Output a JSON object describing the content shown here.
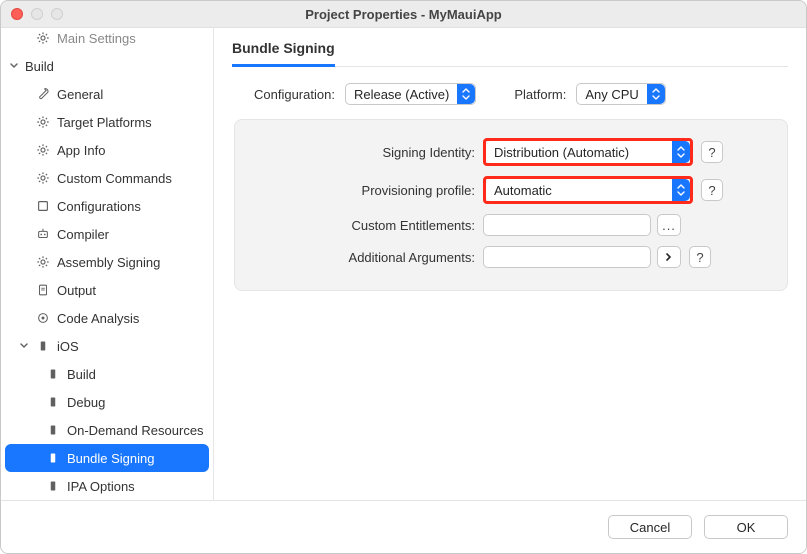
{
  "window": {
    "title": "Project Properties - MyMauiApp"
  },
  "sidebar": {
    "truncated_top": "Main Settings",
    "groups": [
      {
        "label": "Build",
        "items": [
          {
            "label": "General",
            "icon": "wrench"
          },
          {
            "label": "Target Platforms",
            "icon": "gear"
          },
          {
            "label": "App Info",
            "icon": "gear"
          },
          {
            "label": "Custom Commands",
            "icon": "gear"
          },
          {
            "label": "Configurations",
            "icon": "square"
          },
          {
            "label": "Compiler",
            "icon": "robot"
          },
          {
            "label": "Assembly Signing",
            "icon": "gear"
          },
          {
            "label": "Output",
            "icon": "doc"
          },
          {
            "label": "Code Analysis",
            "icon": "target"
          }
        ]
      },
      {
        "label": "iOS",
        "icon": "device",
        "items": [
          {
            "label": "Build",
            "icon": "device"
          },
          {
            "label": "Debug",
            "icon": "device"
          },
          {
            "label": "On-Demand Resources",
            "icon": "device"
          },
          {
            "label": "Bundle Signing",
            "icon": "device",
            "selected": true
          },
          {
            "label": "IPA Options",
            "icon": "device"
          }
        ]
      }
    ]
  },
  "main": {
    "heading": "Bundle Signing",
    "config": {
      "configuration_label": "Configuration:",
      "configuration_value": "Release (Active)",
      "platform_label": "Platform:",
      "platform_value": "Any CPU"
    },
    "form": {
      "signing_label": "Signing Identity:",
      "signing_value": "Distribution (Automatic)",
      "provisioning_label": "Provisioning profile:",
      "provisioning_value": "Automatic",
      "entitlements_label": "Custom Entitlements:",
      "entitlements_value": "",
      "arguments_label": "Additional Arguments:",
      "arguments_value": "",
      "help": "?",
      "browse": "..."
    }
  },
  "footer": {
    "cancel": "Cancel",
    "ok": "OK"
  }
}
